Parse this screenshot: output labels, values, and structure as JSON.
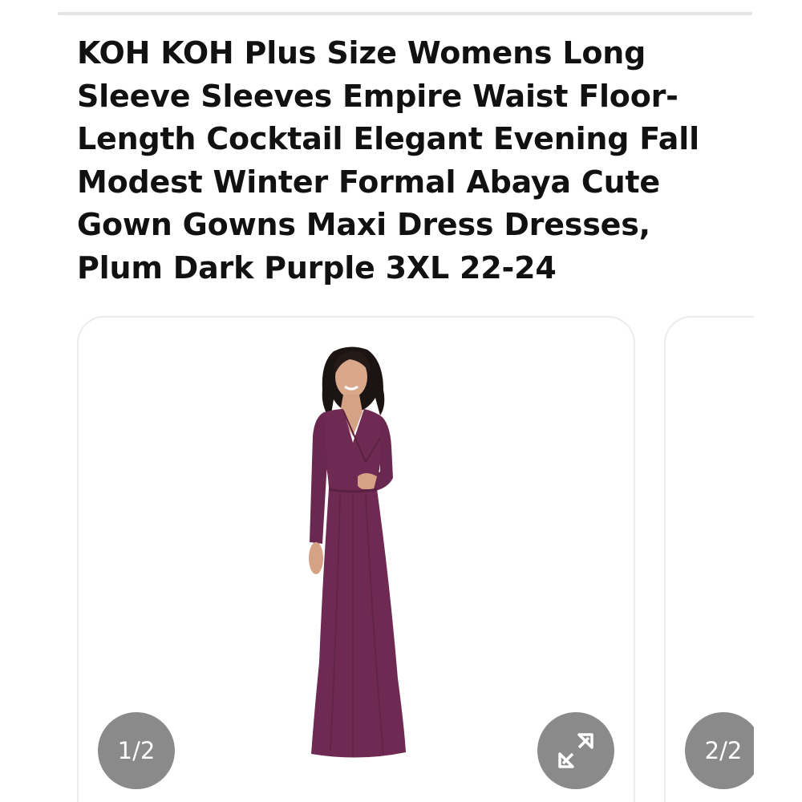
{
  "product": {
    "title": "KOH KOH Plus Size Womens Long Sleeve Sleeves Empire Waist Floor-Length Cocktail Elegant Evening Fall Modest Winter Formal Abaya Cute Gown Gowns Maxi Dress Dresses, Plum Dark Purple 3XL 22-24"
  },
  "gallery": {
    "slides": [
      {
        "counter": "1/2",
        "icon": "dress-photo",
        "expand_icon": "expand-arrows-icon"
      },
      {
        "counter": "2/2"
      }
    ]
  },
  "colors": {
    "dress": "#6e2a52",
    "badge": "#8a8a8a",
    "divider": "#e3e3e3",
    "title_text": "#111111"
  }
}
